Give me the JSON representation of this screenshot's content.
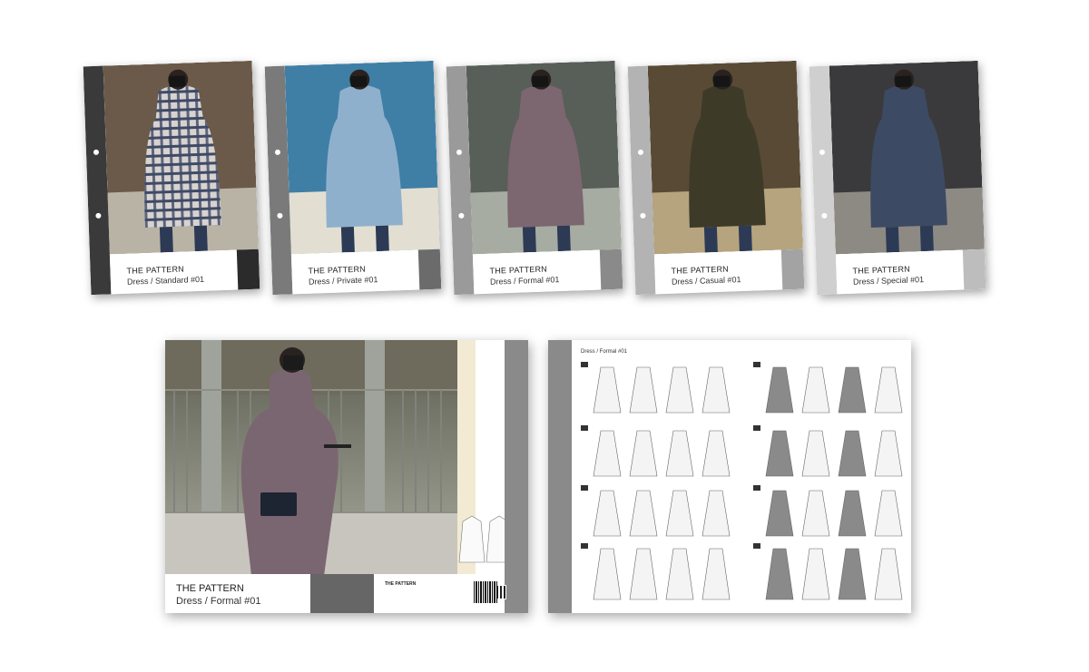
{
  "cards": [
    {
      "title": "THE PATTERN",
      "subtitle": "Dress / Standard #01",
      "spine": "#3a3a3a",
      "tag": "#2b2b2b",
      "bg1": "#6b5a49",
      "bg2": "#b9b3a6",
      "dress": "#4b5566",
      "pattern": "plaid"
    },
    {
      "title": "THE PATTERN",
      "subtitle": "Dress / Private #01",
      "spine": "#7a7a7a",
      "tag": "#6b6b6b",
      "bg1": "#3f7fa6",
      "bg2": "#e2dfd2",
      "dress": "#8fb0cc",
      "pattern": "plain"
    },
    {
      "title": "THE PATTERN",
      "subtitle": "Dress / Formal #01",
      "spine": "#9a9a9a",
      "tag": "#8a8a8a",
      "bg1": "#585e58",
      "bg2": "#a6aca2",
      "dress": "#7c6670",
      "pattern": "plain"
    },
    {
      "title": "THE PATTERN",
      "subtitle": "Dress / Casual #01",
      "spine": "#b3b3b3",
      "tag": "#a3a3a3",
      "bg1": "#594a36",
      "bg2": "#b6a47e",
      "dress": "#3d3a28",
      "pattern": "plain"
    },
    {
      "title": "THE PATTERN",
      "subtitle": "Dress / Special #01",
      "spine": "#cfcfcf",
      "tag": "#bdbdbd",
      "bg1": "#3a3a3c",
      "bg2": "#8d8a84",
      "dress": "#3d4a63",
      "pattern": "denim"
    }
  ],
  "booklet": {
    "title": "THE PATTERN",
    "subtitle": "Dress / Formal #01",
    "brand": "THE PATTERN"
  },
  "sheet": {
    "header": "Dress / Formal #01"
  }
}
